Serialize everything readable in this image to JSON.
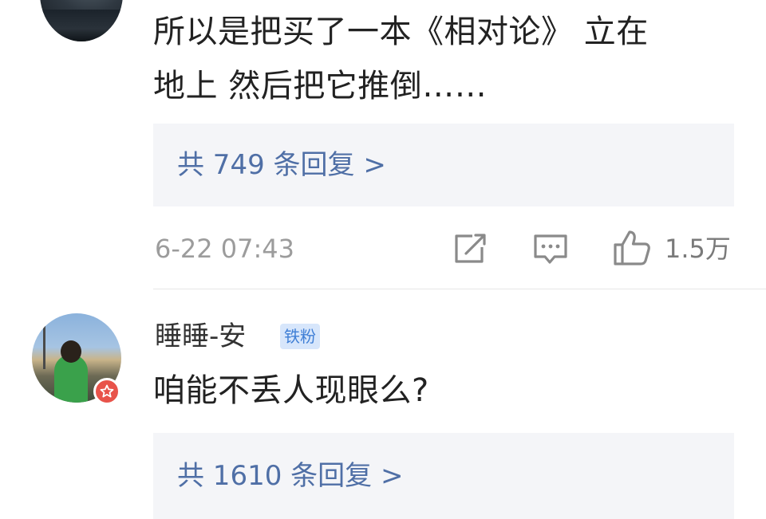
{
  "comments": [
    {
      "text_lines": [
        "所以是把买了一本《相对论》 立在",
        "地上 然后把它推倒……"
      ],
      "replies_label": "共 749 条回复 >",
      "timestamp": "6-22 07:43",
      "likes": "1.5万"
    },
    {
      "username": "睡睡-安",
      "badge": "铁粉",
      "text": "咱能不丢人现眼么?",
      "replies_label": "共 1610 条回复 >"
    }
  ],
  "icons": {
    "share": "edit-share-icon",
    "comment": "comment-bubble-icon",
    "like": "thumbs-up-icon",
    "vip": "star-badge-icon"
  },
  "colors": {
    "link": "#4f6fa6",
    "badge_bg": "#d7e6fb",
    "badge_text": "#3f7fd6",
    "vip_badge": "#e8534a"
  }
}
